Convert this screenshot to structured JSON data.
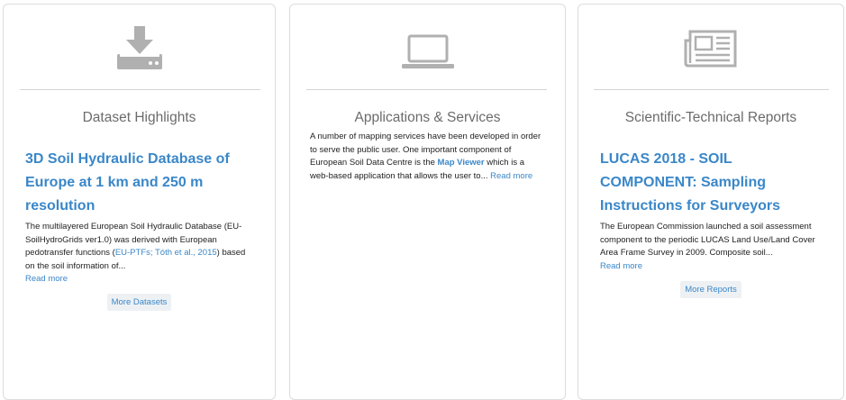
{
  "cards": [
    {
      "icon": "download-icon",
      "title": "Dataset Highlights",
      "item_title": "3D Soil Hydraulic Database of Europe at 1 km and 250 m resolution",
      "desc_pre": "The multilayered European Soil Hydraulic Database (EU-SoilHydroGrids ver1.0) was derived with European pedotransfer functions (",
      "link1": "EU-PTFs;",
      "link2": "Tóth et al., 2015",
      "desc_post": ") based on the soil information of...",
      "read_more": "Read more",
      "button": "More Datasets"
    },
    {
      "icon": "laptop-icon",
      "title": "Applications & Services",
      "desc_pre": "A number of mapping services have been developed in order to serve the public user. One important component of European Soil Data Centre is the ",
      "link_strong": "Map Viewer",
      "desc_post": " which is a web-based application that allows the user to...",
      "read_more": "Read more"
    },
    {
      "icon": "newspaper-icon",
      "title": "Scientific-Technical Reports",
      "item_title": "LUCAS 2018 - SOIL COMPONENT: Sampling Instructions for Surveyors",
      "desc": "The European Commission launched a soil assessment component to the periodic LUCAS Land Use/Land Cover Area Frame Survey in 2009. Composite soil...",
      "read_more": "Read more",
      "button": "More Reports"
    }
  ],
  "colors": {
    "link": "#3a87c8",
    "icon": "#b0b0b0"
  }
}
